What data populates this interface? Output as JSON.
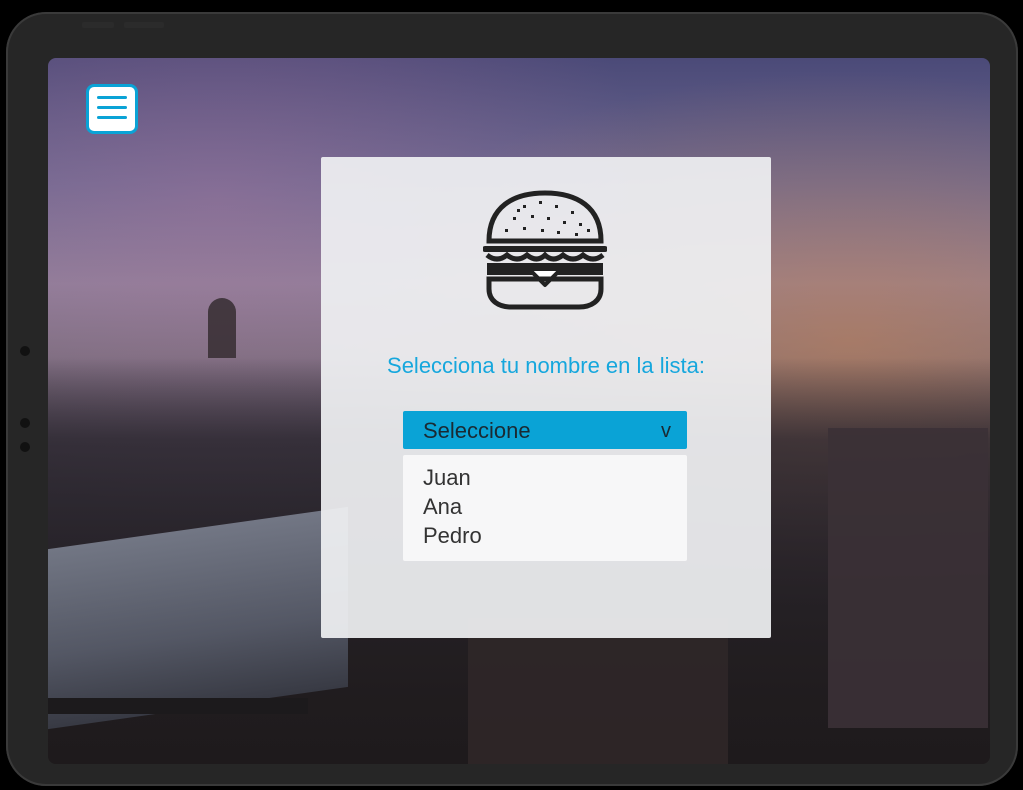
{
  "menu": {
    "icon": "hamburger-menu-icon"
  },
  "dialog": {
    "icon": "burger-icon",
    "prompt": "Selecciona tu nombre en la lista:",
    "select": {
      "value": "Seleccione",
      "arrow": "v"
    },
    "options": [
      "Juan",
      "Ana",
      "Pedro"
    ]
  },
  "colors": {
    "accent": "#0aa3d6",
    "prompt_text": "#16a7dd",
    "panel_bg": "#eff0f2"
  }
}
